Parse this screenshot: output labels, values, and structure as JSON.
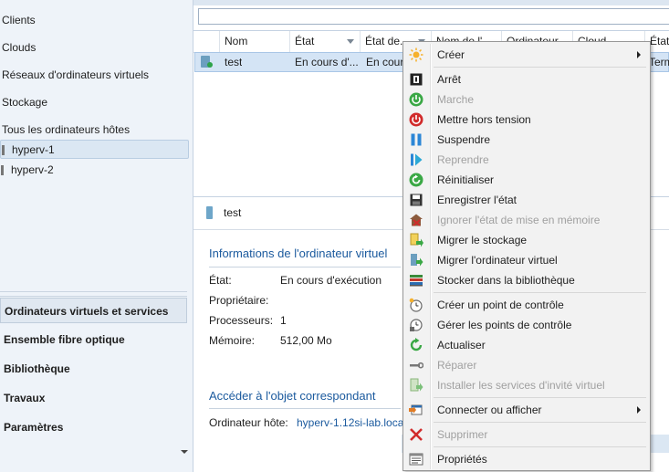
{
  "nav": {
    "items": [
      "Clients",
      "Clouds",
      "Réseaux d'ordinateurs virtuels",
      "Stockage",
      "Tous les ordinateurs hôtes"
    ],
    "hosts": [
      "hyperv-1",
      "hyperv-2"
    ],
    "workspaces": [
      "Ordinateurs virtuels et services",
      "Ensemble fibre optique",
      "Bibliothèque",
      "Travaux",
      "Paramètres"
    ]
  },
  "grid": {
    "columns": [
      "Nom",
      "État",
      "État de...",
      "Nom de l'...",
      "Ordinateur...",
      "Cloud",
      "État"
    ],
    "rows": [
      {
        "name": "test",
        "state": "En cours d'...",
        "state2": "En cours",
        "last": "Termi"
      }
    ]
  },
  "details": {
    "vm_name": "test",
    "section_title": "Informations de l'ordinateur virtuel",
    "fields": [
      {
        "label": "État:",
        "value": "En cours d'exécution"
      },
      {
        "label": "Propriétaire:",
        "value": ""
      },
      {
        "label": "Processeurs:",
        "value": "1"
      },
      {
        "label": "Mémoire:",
        "value": "512,00 Mo"
      }
    ],
    "link_section_title": "Accéder à l'objet correspondant",
    "host_label": "Ordinateur hôte:",
    "host_value": "hyperv-1.12si-lab.loca"
  },
  "context_menu": {
    "items": [
      {
        "label": "Créer",
        "icon": "create-sun-icon",
        "enabled": true,
        "submenu": true
      },
      {
        "label": "Arrêt",
        "icon": "stop-icon",
        "enabled": true
      },
      {
        "label": "Marche",
        "icon": "power-on-icon",
        "enabled": false
      },
      {
        "label": "Mettre hors tension",
        "icon": "power-off-icon",
        "enabled": true
      },
      {
        "label": "Suspendre",
        "icon": "pause-icon",
        "enabled": true
      },
      {
        "label": "Reprendre",
        "icon": "resume-icon",
        "enabled": false
      },
      {
        "label": "Réinitialiser",
        "icon": "reset-icon",
        "enabled": true
      },
      {
        "label": "Enregistrer l'état",
        "icon": "save-state-icon",
        "enabled": true
      },
      {
        "label": "Ignorer l'état de mise en mémoire",
        "icon": "discard-state-icon",
        "enabled": false
      },
      {
        "label": "Migrer le stockage",
        "icon": "migrate-storage-icon",
        "enabled": true
      },
      {
        "label": "Migrer l'ordinateur virtuel",
        "icon": "migrate-vm-icon",
        "enabled": true
      },
      {
        "label": "Stocker dans la bibliothèque",
        "icon": "library-icon",
        "enabled": true
      },
      {
        "label": "Créer un point de contrôle",
        "icon": "checkpoint-create-icon",
        "enabled": true
      },
      {
        "label": "Gérer les points de contrôle",
        "icon": "checkpoint-manage-icon",
        "enabled": true
      },
      {
        "label": "Actualiser",
        "icon": "refresh-icon",
        "enabled": true
      },
      {
        "label": "Réparer",
        "icon": "repair-icon",
        "enabled": false
      },
      {
        "label": "Installer les services d'invité virtuel",
        "icon": "guest-services-icon",
        "enabled": false
      },
      {
        "label": "Connecter ou afficher",
        "icon": "connect-icon",
        "enabled": true,
        "submenu": true
      },
      {
        "label": "Supprimer",
        "icon": "delete-icon",
        "enabled": false
      },
      {
        "label": "Propriétés",
        "icon": "properties-icon",
        "enabled": true
      }
    ]
  },
  "colors": {
    "accent_link": "#1b5a9e",
    "selection": "#d4e4f5",
    "nav_bg": "#eef3f9",
    "menu_bg": "#f2f2f2"
  }
}
